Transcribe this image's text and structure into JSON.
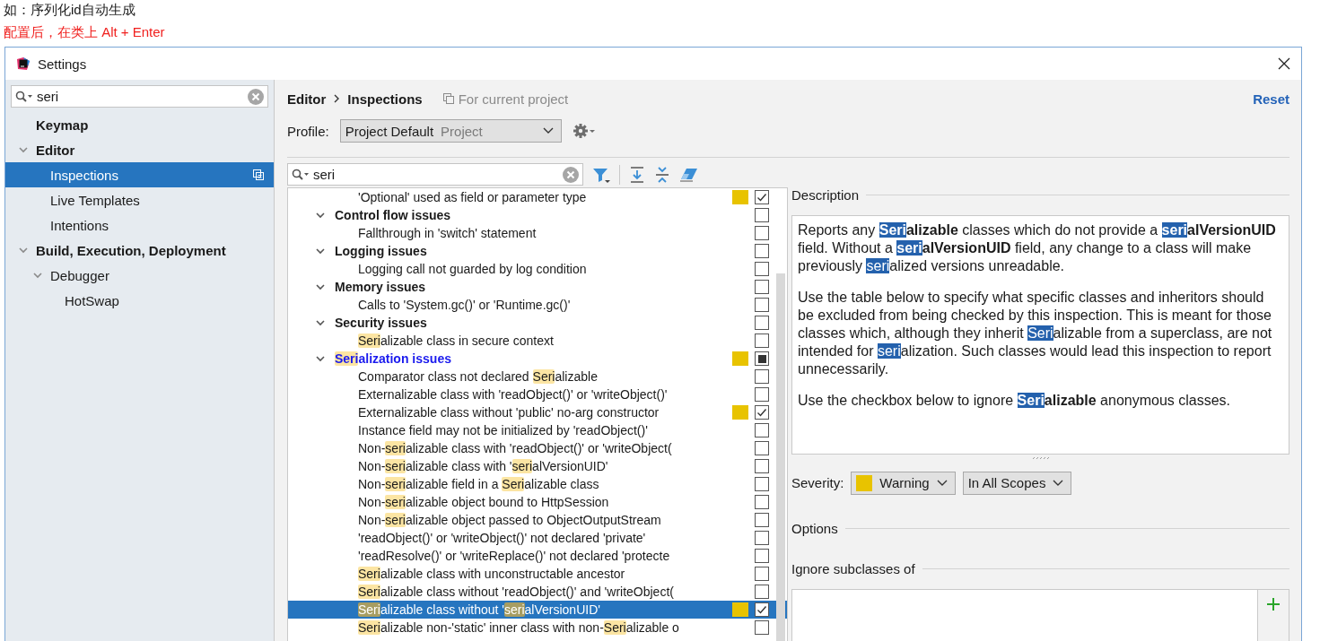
{
  "captions": [
    {
      "kind": "note",
      "text": "如：序列化id自动生成"
    },
    {
      "kind": "hint",
      "text": "配置后，在类上 Alt + Enter"
    }
  ],
  "window": {
    "title": "Settings"
  },
  "sidebar": {
    "search": {
      "value": "seri"
    },
    "items": [
      {
        "label": "Keymap",
        "selected": false
      },
      {
        "label": "Editor",
        "expanded": true,
        "selected": false,
        "children": [
          {
            "label": "Inspections",
            "selected": true,
            "project_scope": true
          },
          {
            "label": "Live Templates",
            "selected": false,
            "project_scope": false
          },
          {
            "label": "Intentions",
            "selected": false,
            "project_scope": false
          }
        ]
      },
      {
        "label": "Build, Execution, Deployment",
        "expanded": true,
        "selected": false,
        "children": [
          {
            "label": "Debugger",
            "expanded": true,
            "selected": false,
            "children": [
              {
                "label": "HotSwap",
                "selected": false
              }
            ]
          }
        ]
      }
    ]
  },
  "breadcrumb": [
    "Editor",
    "Inspections"
  ],
  "scope_note": "For current project",
  "reset": "Reset",
  "profile": {
    "label": "Profile:",
    "value": "Project Default",
    "scope": "Project"
  },
  "inspections": {
    "search": {
      "value": "seri"
    },
    "tree": [
      {
        "kind": "item",
        "text": "'Optional' used as field or parameter type",
        "color": "#e8c300",
        "checked": true,
        "selected": false
      },
      {
        "kind": "group",
        "text": "Control flow issues",
        "expanded": true,
        "modified": false,
        "checked": false,
        "partial": false,
        "selected": false,
        "children": [
          {
            "kind": "item",
            "text": "Fallthrough in 'switch' statement",
            "checked": false,
            "selected": false
          }
        ]
      },
      {
        "kind": "group",
        "text": "Logging issues",
        "expanded": true,
        "modified": false,
        "checked": false,
        "partial": false,
        "selected": false,
        "children": [
          {
            "kind": "item",
            "text": "Logging call not guarded by log condition",
            "checked": false,
            "selected": false
          }
        ]
      },
      {
        "kind": "group",
        "text": "Memory issues",
        "expanded": true,
        "modified": false,
        "checked": false,
        "partial": false,
        "selected": false,
        "children": [
          {
            "kind": "item",
            "text": "Calls to 'System.gc()' or 'Runtime.gc()'",
            "checked": false,
            "selected": false
          }
        ]
      },
      {
        "kind": "group",
        "text": "Security issues",
        "expanded": true,
        "modified": false,
        "checked": false,
        "partial": false,
        "selected": false,
        "children": [
          {
            "kind": "item",
            "text": "Serializable class in secure context",
            "checked": false,
            "selected": false
          }
        ]
      },
      {
        "kind": "group",
        "text": "Serialization issues",
        "expanded": true,
        "modified": true,
        "color": "#e8c300",
        "checked": false,
        "partial": true,
        "selected": false,
        "children": [
          {
            "kind": "item",
            "text": "Comparator class not declared Serializable",
            "checked": false,
            "selected": false
          },
          {
            "kind": "item",
            "text": "Externalizable class with 'readObject()' or 'writeObject()'",
            "checked": false,
            "selected": false
          },
          {
            "kind": "item",
            "text": "Externalizable class without 'public' no-arg constructor",
            "color": "#e8c300",
            "checked": true,
            "selected": false
          },
          {
            "kind": "item",
            "text": "Instance field may not be initialized by 'readObject()'",
            "checked": false,
            "selected": false
          },
          {
            "kind": "item",
            "text": "Non-serializable class with 'readObject()' or 'writeObject(",
            "checked": false,
            "selected": false
          },
          {
            "kind": "item",
            "text": "Non-serializable class with 'serialVersionUID'",
            "checked": false,
            "selected": false
          },
          {
            "kind": "item",
            "text": "Non-serializable field in a Serializable class",
            "checked": false,
            "selected": false
          },
          {
            "kind": "item",
            "text": "Non-serializable object bound to HttpSession",
            "checked": false,
            "selected": false
          },
          {
            "kind": "item",
            "text": "Non-serializable object passed to ObjectOutputStream",
            "checked": false,
            "selected": false
          },
          {
            "kind": "item",
            "text": "'readObject()' or 'writeObject()' not declared 'private'",
            "checked": false,
            "selected": false
          },
          {
            "kind": "item",
            "text": "'readResolve()' or 'writeReplace()' not declared 'protecte",
            "checked": false,
            "selected": false
          },
          {
            "kind": "item",
            "text": "Serializable class with unconstructable ancestor",
            "checked": false,
            "selected": false
          },
          {
            "kind": "item",
            "text": "Serializable class without 'readObject()' and 'writeObject(",
            "checked": false,
            "selected": false
          },
          {
            "kind": "item",
            "text": "Serializable class without 'serialVersionUID'",
            "color": "#e8c300",
            "checked": true,
            "selected": true
          },
          {
            "kind": "item",
            "text": "Serializable non-'static' inner class with non-Serializable o",
            "checked": false,
            "selected": false
          }
        ]
      }
    ]
  },
  "detail": {
    "description_title": "Description",
    "paragraphs": [
      "Reports any **Serializable** classes which do not provide a **serialVersionUID** field. Without a **serialVersionUID** field, any change to a class will make previously serialized versions unreadable.",
      "Use the table below to specify what specific classes and inheritors should be excluded from being checked by this inspection. This is meant for those classes which, although they inherit Serializable from a superclass, are not intended for serialization. Such classes would lead this inspection to report unnecessarily.",
      "Use the checkbox below to ignore **Serializable** anonymous classes."
    ],
    "severity": {
      "label": "Severity:",
      "value": "Warning",
      "color": "#e8c300",
      "scope": "In All Scopes"
    },
    "options_title": "Options",
    "ignore_title": "Ignore subclasses of"
  }
}
